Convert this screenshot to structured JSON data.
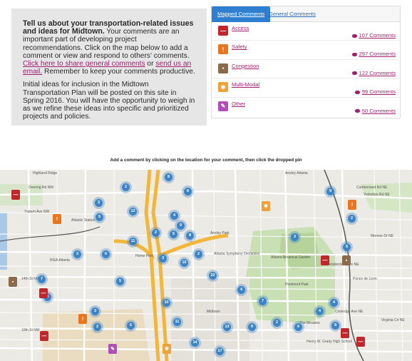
{
  "intro": {
    "bold_lead": "Tell us about your transportation-related issues and ideas for Midtown.",
    "text1": " Your comments are an important part of developing project recommendations. Click on the map below to add a comment or view and respond to others' comments. ",
    "link1": "Click here to share general comments",
    "text2": " or ",
    "link2": "send us an email.",
    "text3": " Remember to keep your comments productive.",
    "para2": "Initial ideas for inclusion in the Midtown Transportation Plan will be posted on this site in Spring 2016. You will have the opportunity to weigh in as we refine these ideas into specific and prioritized projects and policies."
  },
  "tabs": {
    "mapped": "Mapped Comments",
    "general": "General Comments"
  },
  "categories": [
    {
      "label": "Access",
      "count": "107 Comments",
      "color": "#c0272d",
      "icon": "no-entry-icon",
      "glyph": "—"
    },
    {
      "label": "Safety",
      "count": "297 Comments",
      "color": "#e8761e",
      "icon": "warning-icon",
      "glyph": "!"
    },
    {
      "label": "Congestion",
      "count": "122 Comments",
      "color": "#8a6a4a",
      "icon": "traffic-light-icon",
      "glyph": "▪"
    },
    {
      "label": "Multi-Modal",
      "count": "99 Comments",
      "color": "#f0a23a",
      "icon": "pedestrian-icon",
      "glyph": "✱"
    },
    {
      "label": "Other",
      "count": "50 Comments",
      "color": "#b04fb8",
      "icon": "chat-icon",
      "glyph": "✎"
    }
  ],
  "map_hint": "Add a comment by clicking on the location for your comment, then click the dropped pin",
  "map": {
    "street_labels": [
      "Deering Rd NW",
      "Trabert Ave NW",
      "Atlantic Station",
      "Ansley Park",
      "Home Park",
      "14th St NW",
      "10th St NW",
      "Midtown",
      "Atlanta Botanical Garden",
      "Piedmont Park",
      "The Meadow",
      "Virginia Cir NE",
      "Cumberland Rd NE",
      "Yorkshire Rd NE",
      "Monroe Dr NE",
      "Ponce de Leon",
      "Highland Ridge",
      "Ansley Atlanta",
      "Atlanta Symphony Orchestra",
      "IKEA Atlanta",
      "Cooledge Ave NE",
      "Henry W. Grady High School",
      "Amsterdam Ave NE"
    ]
  },
  "clusters": [
    "8",
    "2",
    "6",
    "3",
    "5",
    "12",
    "4",
    "9",
    "11",
    "2",
    "5",
    "8",
    "3",
    "6",
    "22",
    "17",
    "13",
    "9",
    "7",
    "4",
    "2",
    "3",
    "15",
    "5",
    "10",
    "6",
    "3",
    "2",
    "11",
    "14",
    "3",
    "2",
    "9",
    "4",
    "6",
    "4",
    "2",
    "5",
    "8",
    "7",
    "3"
  ]
}
